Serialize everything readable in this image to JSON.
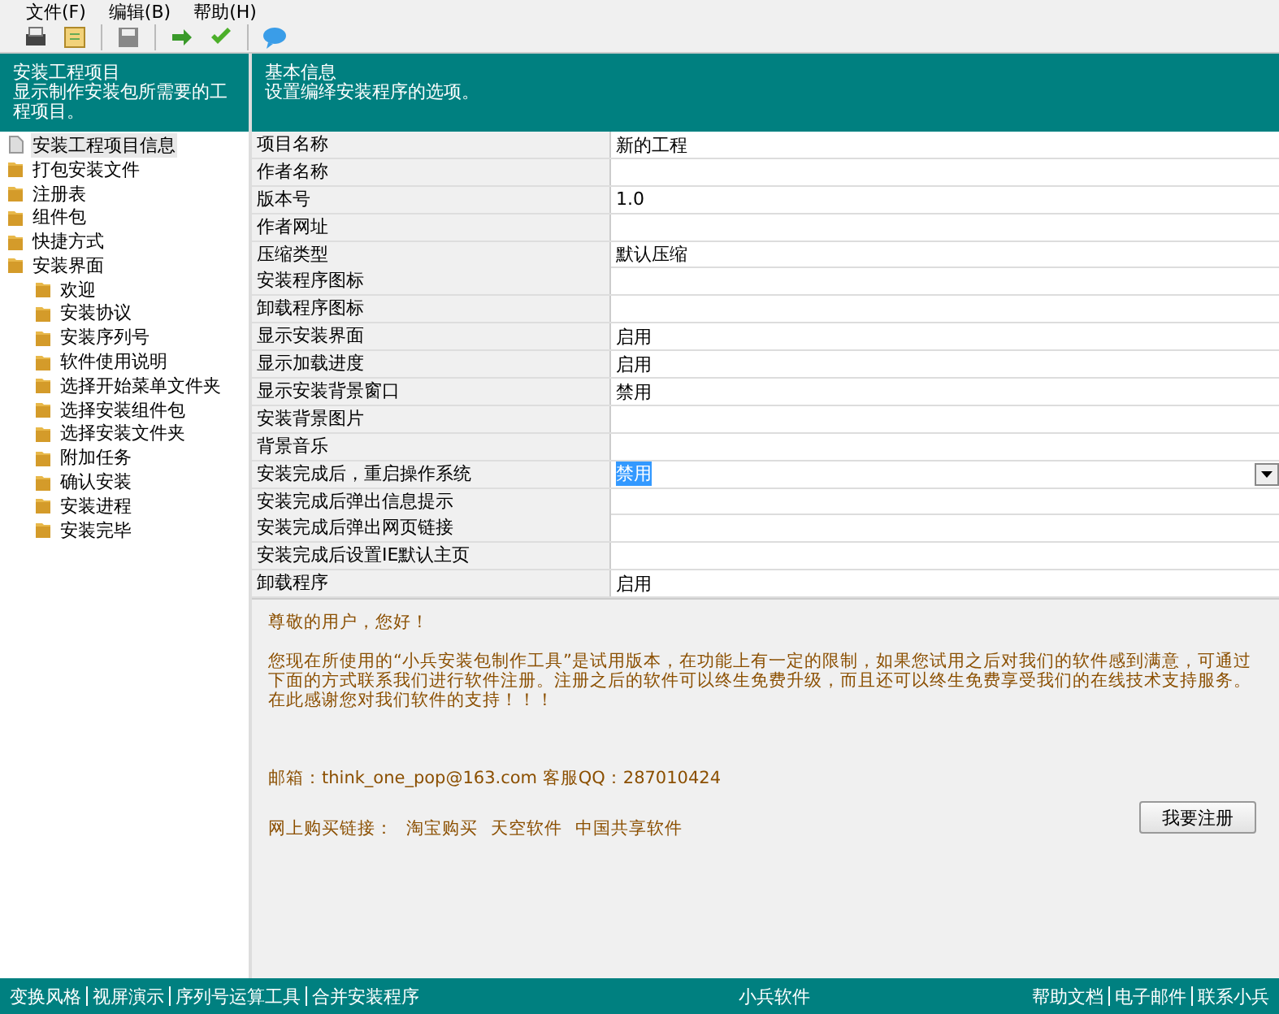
{
  "menu": [
    "文件(F)",
    "编辑(B)",
    "帮助(H)"
  ],
  "left_header": {
    "title": "安装工程项目",
    "subtitle": "显示制作安装包所需要的工程项目。"
  },
  "tree": [
    {
      "label": "安装工程项目信息",
      "selected": true,
      "kind": "doc"
    },
    {
      "label": "打包安装文件",
      "selected": false,
      "kind": "folder"
    },
    {
      "label": "注册表",
      "selected": false,
      "kind": "folder"
    },
    {
      "label": "组件包",
      "selected": false,
      "kind": "folder"
    },
    {
      "label": "快捷方式",
      "selected": false,
      "kind": "folder"
    },
    {
      "label": "安装界面",
      "selected": false,
      "kind": "folder",
      "children": [
        {
          "label": "欢迎",
          "selected": false,
          "kind": "folder"
        },
        {
          "label": "安装协议",
          "selected": false,
          "kind": "folder"
        },
        {
          "label": "安装序列号",
          "selected": false,
          "kind": "folder"
        },
        {
          "label": "软件使用说明",
          "selected": false,
          "kind": "folder"
        },
        {
          "label": "选择开始菜单文件夹",
          "selected": false,
          "kind": "folder"
        },
        {
          "label": "选择安装组件包",
          "selected": false,
          "kind": "folder"
        },
        {
          "label": "选择安装文件夹",
          "selected": false,
          "kind": "folder"
        },
        {
          "label": "附加任务",
          "selected": false,
          "kind": "folder"
        },
        {
          "label": "确认安装",
          "selected": false,
          "kind": "folder"
        },
        {
          "label": "安装进程",
          "selected": false,
          "kind": "folder"
        },
        {
          "label": "安装完毕",
          "selected": false,
          "kind": "folder"
        }
      ]
    }
  ],
  "right_header": {
    "title": "基本信息",
    "subtitle": "设置编绎安装程序的选项。"
  },
  "properties": [
    {
      "name": "项目名称",
      "value": "新的工程",
      "kind": "text"
    },
    {
      "name": "作者名称",
      "kind": "text"
    },
    {
      "name": "版本号",
      "value": "1.0",
      "kind": "text"
    },
    {
      "name": "作者网址",
      "kind": "text"
    },
    {
      "name": "压缩类型",
      "value": "默认压缩",
      "kind": "text"
    },
    {
      "name": "安装程序图标",
      "kind": "text"
    },
    {
      "name": "卸载程序图标",
      "kind": "text"
    },
    {
      "name": "显示安装界面",
      "value": "启用",
      "kind": "text"
    },
    {
      "name": "显示加载进度",
      "value": "启用",
      "kind": "text"
    },
    {
      "name": "显示安装背景窗口",
      "value": "禁用",
      "kind": "text"
    },
    {
      "name": "安装背景图片",
      "kind": "text"
    },
    {
      "name": "背景音乐",
      "kind": "text"
    },
    {
      "name": "安装完成后，重启操作系统",
      "value": "禁用",
      "kind": "dropdown"
    },
    {
      "name": "安装完成后弹出信息提示",
      "kind": "text"
    },
    {
      "name": "安装完成后弹出网页链接",
      "kind": "text"
    },
    {
      "name": "安装完成后设置IE默认主页",
      "kind": "text"
    },
    {
      "name": "卸载程序",
      "value": "启用",
      "kind": "text"
    }
  ],
  "notice": {
    "greeting": "尊敬的用户，您好！",
    "body": "您现在所使用的“小兵安装包制作工具”是试用版本，在功能上有一定的限制，如果您试用之后对我们的软件感到满意，可通过下面的方式联系我们进行软件注册。注册之后的软件可以终生免费升级，而且还可以终生免费享受我们的在线技术支持服务。在此感谢您对我们软件的支持！！！",
    "contact": "邮箱：think_one_pop@163.com 客服QQ：287010424",
    "buy_label": "网上购买链接：",
    "buy_links": [
      "淘宝购买",
      "天空软件",
      "中国共享软件"
    ],
    "register_button": "我要注册"
  },
  "status_bar": {
    "left_links": [
      "变换风格",
      "视屏演示",
      "序列号运算工具",
      "合并安装程序"
    ],
    "center": "小兵软件",
    "right_links": [
      "帮助文档",
      "电子邮件",
      "联系小兵"
    ]
  }
}
